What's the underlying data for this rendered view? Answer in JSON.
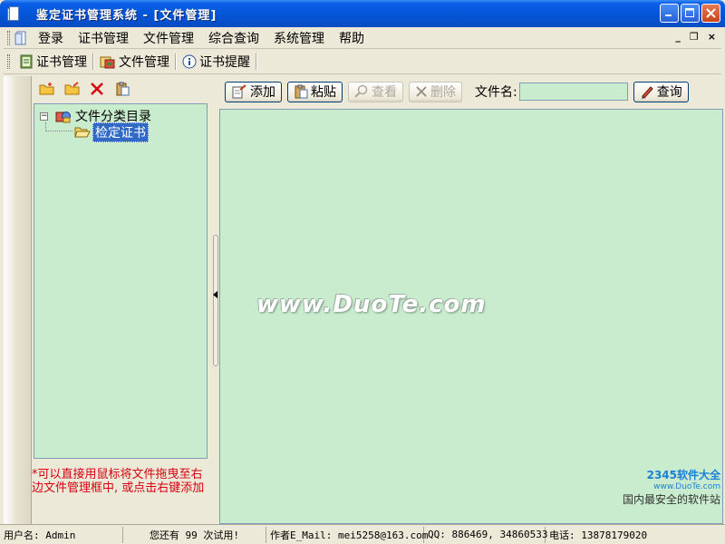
{
  "window": {
    "title": "鉴定证书管理系统 - [文件管理]"
  },
  "menu": {
    "items": [
      "登录",
      "证书管理",
      "文件管理",
      "综合查询",
      "系统管理",
      "帮助"
    ],
    "mdi_min": "_",
    "mdi_restore": "❐",
    "mdi_close": "×"
  },
  "toolbar": {
    "items": [
      "证书管理",
      "文件管理",
      "证书提醒"
    ]
  },
  "tree": {
    "root": "文件分类目录",
    "expander": "−",
    "children": [
      "检定证书"
    ]
  },
  "hint": "*可以直接用鼠标将文件拖曳至右边文件管理框中, 或点击右键添加",
  "file_toolbar": {
    "add": "添加",
    "paste": "粘贴",
    "view": "查看",
    "delete": "删除",
    "filename_label": "文件名:",
    "filename_value": "",
    "query": "查询"
  },
  "watermark": "www.DuoTe.com",
  "corner_logo": {
    "brand": "2345软件大全",
    "url": "www.DuoTe.com",
    "tagline": "国内最安全的软件站"
  },
  "status": {
    "user": "用户名: Admin",
    "trial": "您还有 99 次试用!",
    "email": "作者E_Mail: mei5258@163.com",
    "qq": "QQ: 886469, 34860533",
    "phone": "电话: 13878179020"
  },
  "colors": {
    "titlebar": "#0453d4",
    "panel_bg": "#c8eccd",
    "hint_text": "#d7000f",
    "selection": "#316ac5"
  }
}
